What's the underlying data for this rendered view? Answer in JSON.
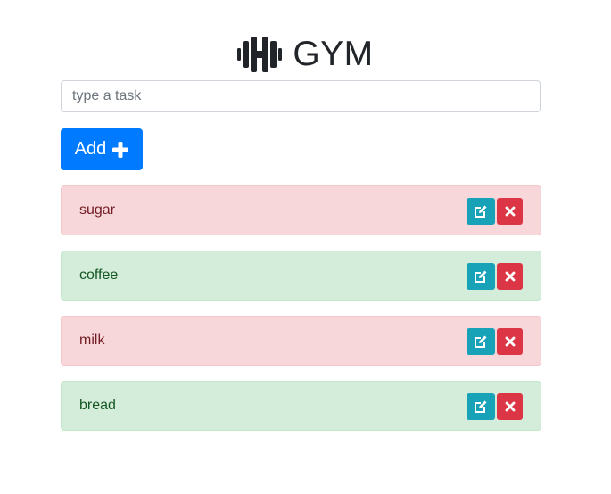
{
  "header": {
    "title": "GYM",
    "icon": "dumbbell-icon"
  },
  "form": {
    "task_placeholder": "type a task",
    "task_value": "",
    "add_label": "Add",
    "add_icon": "plus-icon",
    "add_color": "#007bff"
  },
  "tasks": [
    {
      "text": "sugar",
      "status": "pending"
    },
    {
      "text": "coffee",
      "status": "done"
    },
    {
      "text": "milk",
      "status": "pending"
    },
    {
      "text": "bread",
      "status": "done"
    }
  ],
  "colors": {
    "pending_bg": "#f8d7da",
    "done_bg": "#d4edda",
    "edit_button": "#17a2b8",
    "delete_button": "#dc3545"
  },
  "icons": {
    "edit": "edit-icon",
    "delete": "close-icon"
  }
}
